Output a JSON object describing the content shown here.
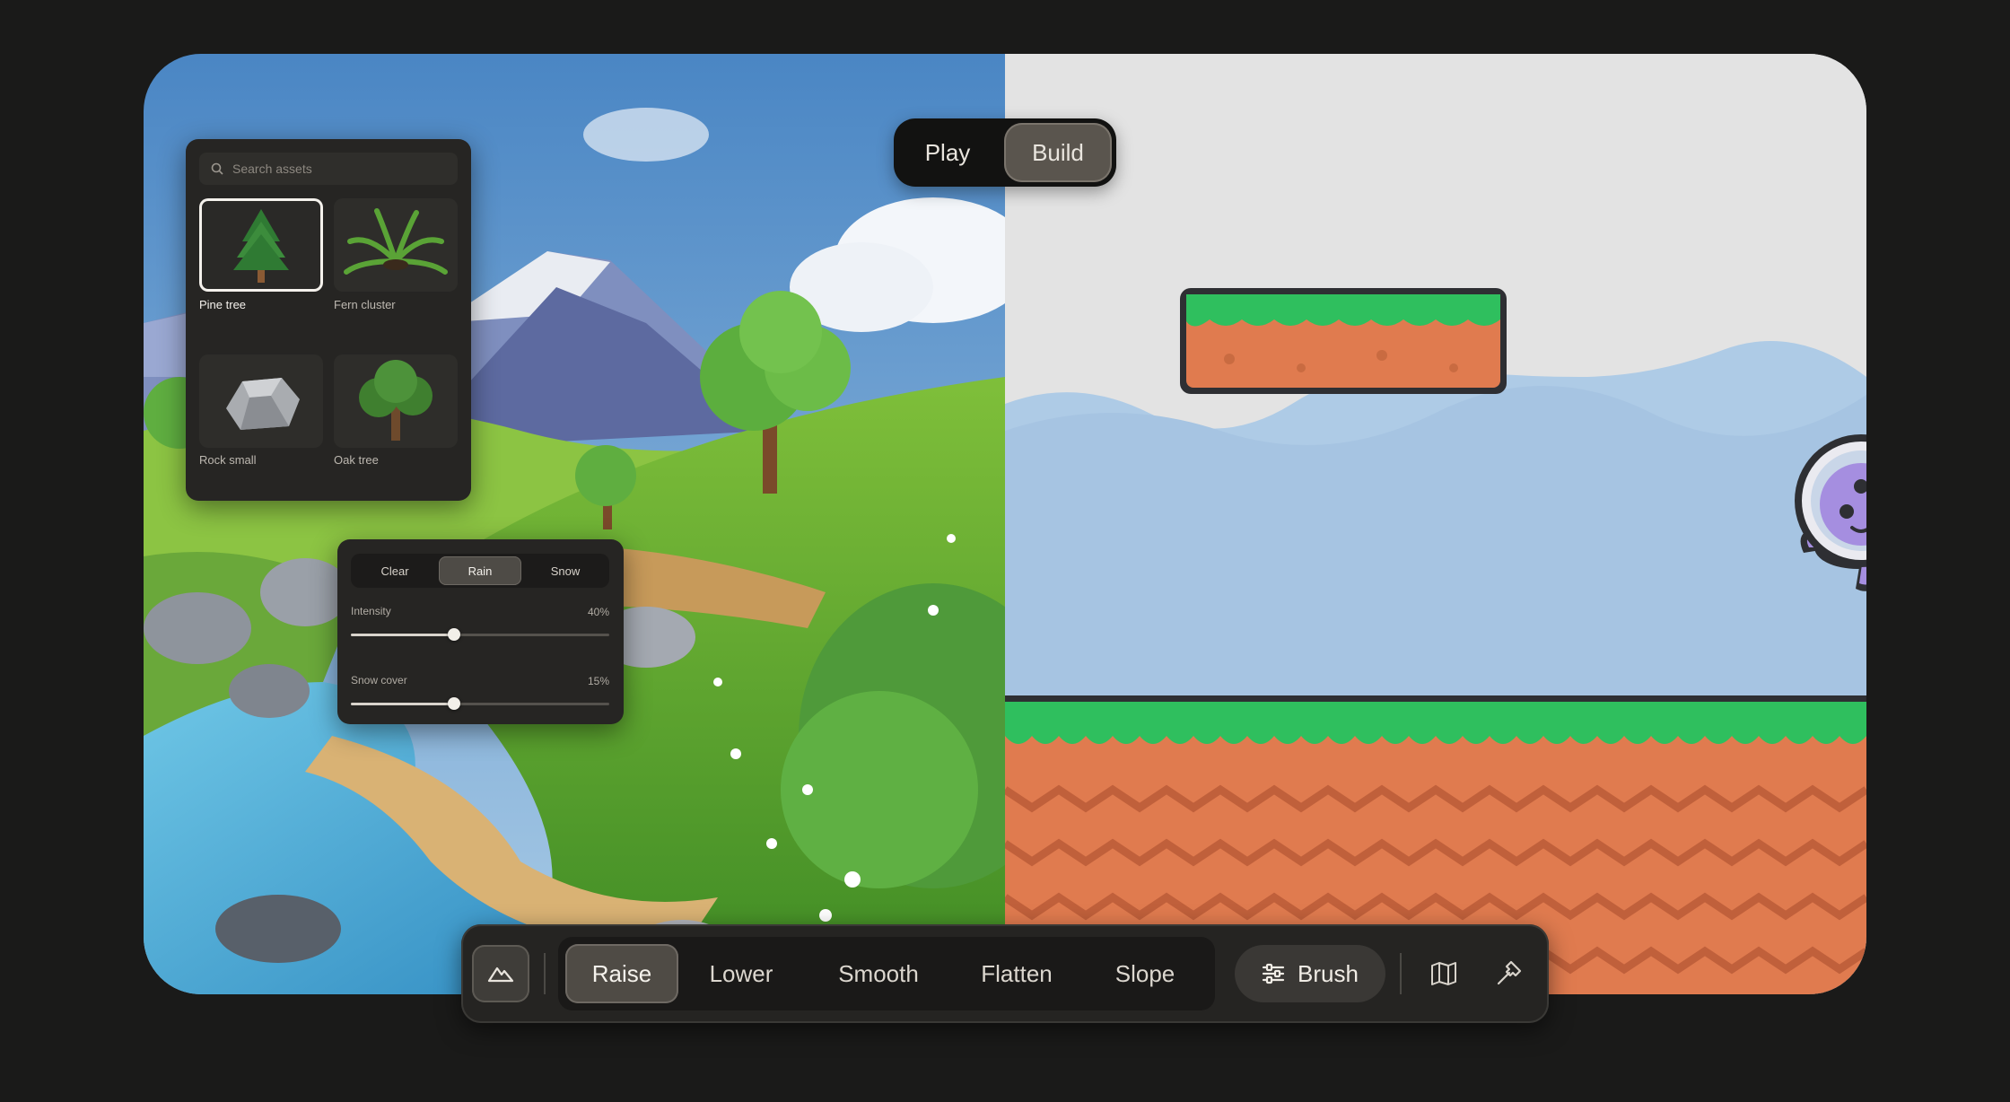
{
  "assets_panel": {
    "search_placeholder": "Search assets",
    "items": [
      {
        "label": "Pine tree",
        "selected": true
      },
      {
        "label": "Fern cluster",
        "selected": false
      },
      {
        "label": "Rock small",
        "selected": false
      },
      {
        "label": "Oak tree",
        "selected": false
      }
    ]
  },
  "weather_panel": {
    "options": [
      "Clear",
      "Rain",
      "Snow"
    ],
    "selected": "Rain",
    "intensity": {
      "label": "Intensity",
      "value_text": "40%",
      "value": 0.4
    },
    "snow_cover": {
      "label": "Snow cover",
      "value_text": "15%",
      "value": 0.4
    }
  },
  "mode_toggle": {
    "play_label": "Play",
    "build_label": "Build",
    "active": "Build"
  },
  "toolbar": {
    "terrain_icon": "mountain-icon",
    "tools": [
      "Raise",
      "Lower",
      "Smooth",
      "Flatten",
      "Slope"
    ],
    "active_tool": "Raise",
    "brush_label": "Brush",
    "brush_icon": "sliders-icon",
    "map_icon": "map-icon",
    "hammer_icon": "hammer-icon"
  },
  "colors": {
    "panel_bg": "#262523",
    "accent_selected": "#4f4b45",
    "grass": "#2fbf5e",
    "dirt": "#e07b4f"
  }
}
